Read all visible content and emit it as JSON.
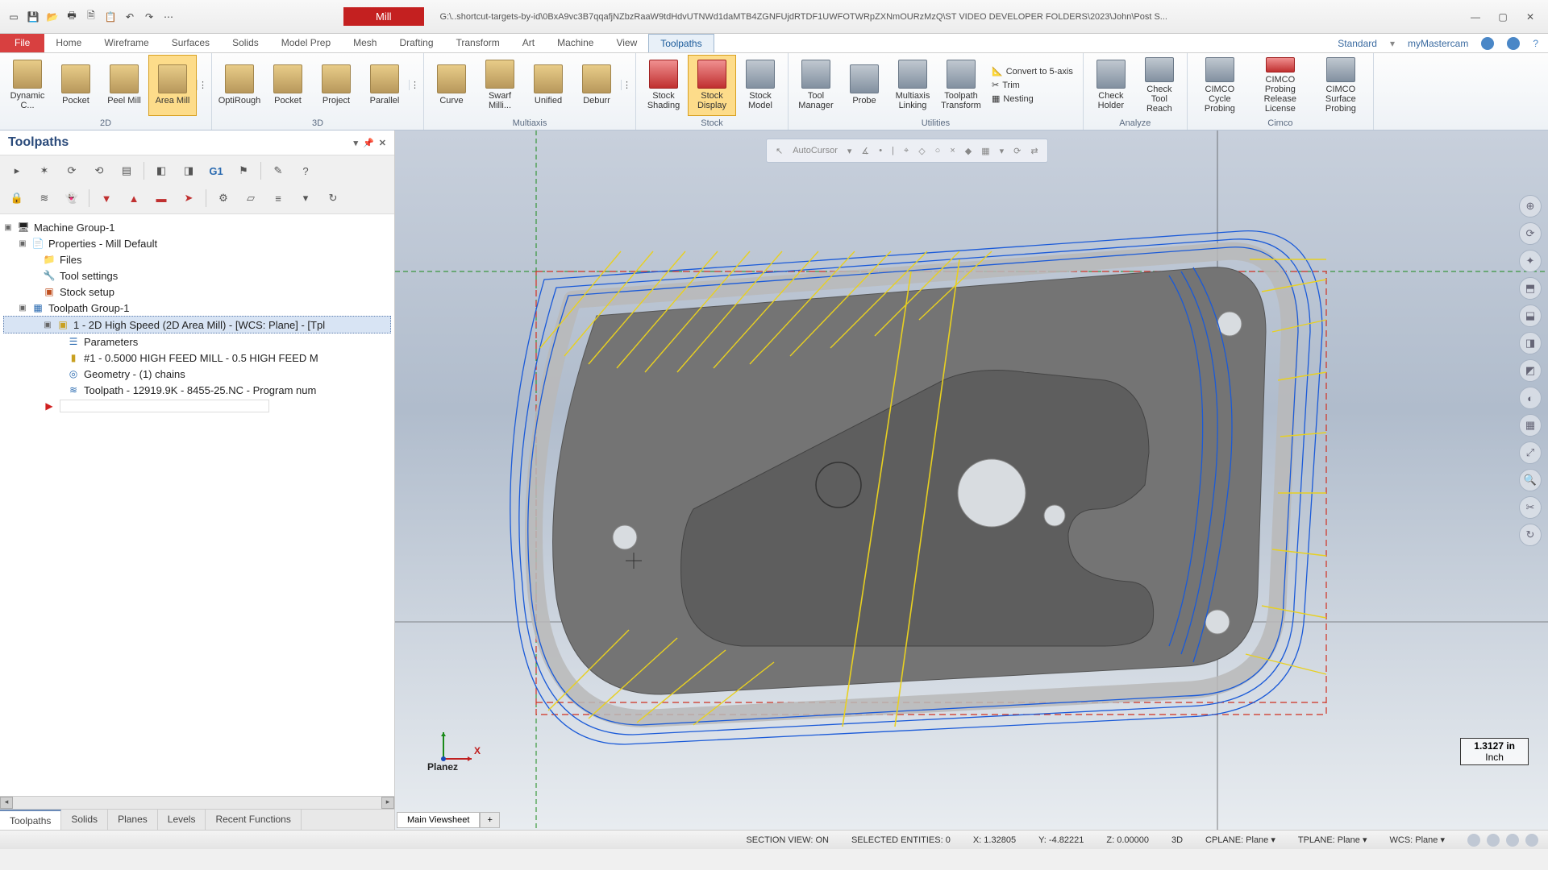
{
  "title": {
    "context_tab": "Mill",
    "path": "G:\\..shortcut-targets-by-id\\0BxA9vc3B7qqafjNZbzRaaW9tdHdvUTNWd1daMTB4ZGNFUjdRTDF1UWFOTWRpZXNmOURzMzQ\\ST VIDEO DEVELOPER FOLDERS\\2023\\John\\Post S..."
  },
  "ribbon": {
    "tabs": [
      "File",
      "Home",
      "Wireframe",
      "Surfaces",
      "Solids",
      "Model Prep",
      "Mesh",
      "Drafting",
      "Transform",
      "Art",
      "Machine",
      "View",
      "Toolpaths"
    ],
    "active_tab": "Toolpaths",
    "right_label_std": "Standard",
    "right_label_my": "myMastercam",
    "groups": {
      "g2d": {
        "label": "2D",
        "items": [
          "Dynamic C...",
          "Pocket",
          "Peel Mill",
          "Area Mill"
        ],
        "selected": "Area Mill"
      },
      "g3d": {
        "label": "3D",
        "items": [
          "OptiRough",
          "Pocket",
          "Project",
          "Parallel"
        ]
      },
      "multiaxis": {
        "label": "Multiaxis",
        "items": [
          "Curve",
          "Swarf Milli...",
          "Unified",
          "Deburr"
        ]
      },
      "stock": {
        "label": "Stock",
        "items": [
          "Stock Shading",
          "Stock Display",
          "Stock Model"
        ],
        "selected": "Stock Display",
        "small": [
          "Convert to 5-axis",
          "Trim",
          "Nesting"
        ]
      },
      "utilities": {
        "label": "Utilities",
        "items": [
          "Tool Manager",
          "Probe",
          "Multiaxis Linking",
          "Toolpath Transform"
        ]
      },
      "analyze": {
        "label": "Analyze",
        "items": [
          "Check Holder",
          "Check Tool Reach"
        ]
      },
      "cimco": {
        "label": "Cimco",
        "items": [
          "CIMCO Cycle Probing",
          "CIMCO Probing Release License",
          "CIMCO Surface Probing"
        ]
      }
    }
  },
  "panel": {
    "title": "Toolpaths",
    "toolbar_g1": "G1",
    "tree": {
      "root": "Machine Group-1",
      "properties": "Properties - Mill Default",
      "files": "Files",
      "tool_settings": "Tool settings",
      "stock_setup": "Stock setup",
      "tp_group": "Toolpath Group-1",
      "op1": "1 - 2D High Speed (2D Area Mill) - [WCS: Plane] - [Tpl",
      "params": "Parameters",
      "tool": "#1 - 0.5000 HIGH FEED MILL - 0.5 HIGH FEED M",
      "geometry": "Geometry - (1) chains",
      "toolpath": "Toolpath - 12919.9K - 8455-25.NC - Program num"
    },
    "bottom_tabs": [
      "Toolpaths",
      "Solids",
      "Planes",
      "Levels",
      "Recent Functions"
    ],
    "active_bottom_tab": "Toolpaths"
  },
  "viewport": {
    "autocursor": "AutoCursor",
    "scale_value": "1.3127 in",
    "scale_unit": "Inch",
    "axis_plane_label": "Planez",
    "axis_x": "X",
    "view_tab": "Main Viewsheet"
  },
  "status": {
    "section_view": "SECTION VIEW: ON",
    "selected": "SELECTED ENTITIES: 0",
    "x_label": "X:",
    "x_val": "1.32805",
    "y_label": "Y:",
    "y_val": "-4.82221",
    "z_label": "Z:",
    "z_val": "0.00000",
    "mode": "3D",
    "cplane": "CPLANE: Plane",
    "tplane": "TPLANE: Plane",
    "wcs": "WCS: Plane"
  }
}
